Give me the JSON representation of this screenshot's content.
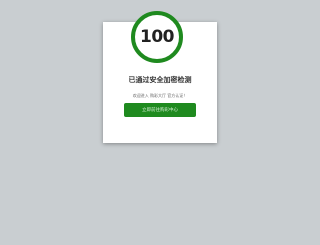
{
  "security_check": {
    "score": "100",
    "title": "已通过安全加密检测",
    "description": "欢迎进入 购彩大厅 官方认证！",
    "button_label": "立即前往购彩中心"
  },
  "colors": {
    "background": "#c9ced1",
    "card": "#ffffff",
    "accent_green": "#1f8a1f"
  }
}
